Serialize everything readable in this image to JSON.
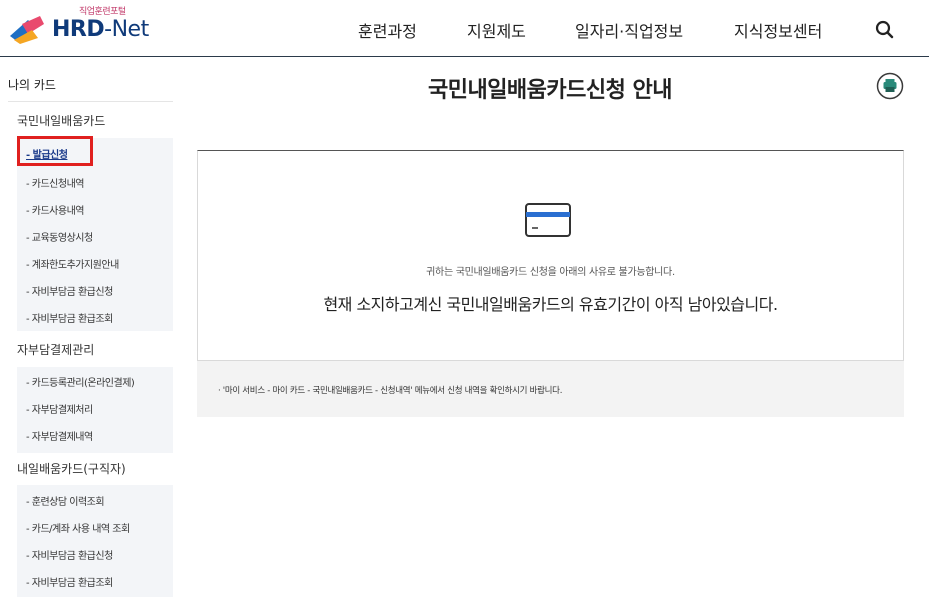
{
  "header": {
    "logo_sub": "직업훈련포털",
    "logo_main": "HRD",
    "logo_dash": "-",
    "logo_net": "Net",
    "nav": [
      "훈련과정",
      "지원제도",
      "일자리·직업정보",
      "지식정보센터"
    ],
    "search_icon": "search-icon"
  },
  "sidebar": {
    "title": "나의 카드",
    "group1": {
      "heading": "국민내일배움카드",
      "items": [
        "- 발급신청",
        "- 카드신청내역",
        "- 카드사용내역",
        "- 교육동영상시청",
        "- 계좌한도추가지원안내",
        "- 자비부담금 환급신청",
        "- 자비부담금 환급조회"
      ]
    },
    "group2": {
      "heading": "자부담결제관리",
      "items": [
        "- 카드등록관리(온라인결제)",
        "- 자부담결제처리",
        "- 자부담결제내역"
      ]
    },
    "group3": {
      "heading": "내일배움카드(구직자)",
      "items": [
        "- 훈련상담 이력조회",
        "- 카드/계좌 사용 내역 조회",
        "- 자비부담금 환급신청",
        "- 자비부담금 환급조회"
      ]
    }
  },
  "main": {
    "title": "국민내일배움카드신청 안내",
    "notice_sub": "귀하는 국민내일배움카드 신청을 아래의 사유로 불가능합니다.",
    "notice_main": "현재 소지하고계신 국민내일배움카드의 유효기간이 아직 남아있습니다.",
    "info": "·   '마이 서비스 - 마이 카드 - 국민내일배움카드 - 신청내역' 메뉴에서 신청 내역을 확인하시기 바랍니다."
  },
  "colors": {
    "brand": "#0f3a7a",
    "highlight": "#e0201f",
    "sidebar_bg": "#f3f5f8"
  }
}
